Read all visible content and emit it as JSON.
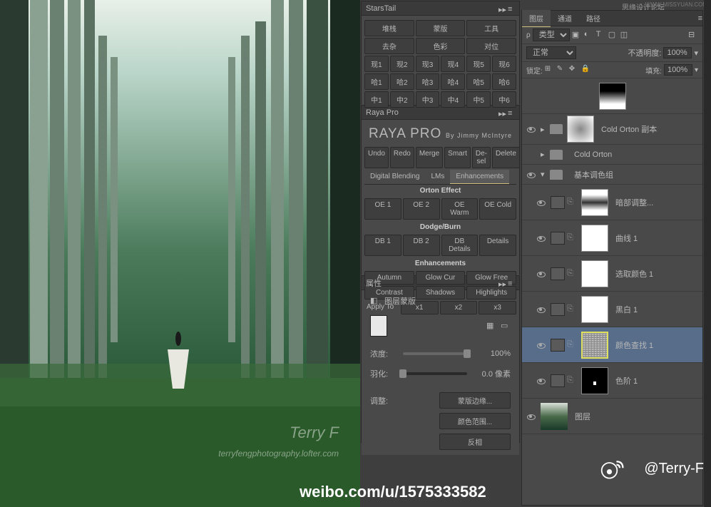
{
  "watermark_top": "思缘设计论坛",
  "watermark_top2": "WWW.MISSYUAN.COM",
  "canvas": {
    "wm_name": "Terry F",
    "wm_site": "terryfengphotography.lofter.com"
  },
  "starsTail": {
    "title": "StarsTail",
    "row1": [
      "堆栈",
      "蒙版",
      "工具"
    ],
    "row2": [
      "去杂",
      "色彩",
      "对位"
    ],
    "row3": [
      "现1",
      "现2",
      "现3",
      "现4",
      "现5",
      "现6"
    ],
    "row4": [
      "哈1",
      "哈2",
      "哈3",
      "哈4",
      "哈5",
      "哈6"
    ],
    "row5": [
      "中1",
      "中2",
      "中3",
      "中4",
      "中5",
      "中6"
    ]
  },
  "rayaPro": {
    "panel_title": "Raya Pro",
    "brand": "RAYA PRO",
    "by": "By Jimmy McIntyre",
    "actions": [
      "Undo",
      "Redo",
      "Merge",
      "Smart",
      "De-sel",
      "Delete"
    ],
    "tabs": [
      "Digital Blending",
      "LMs",
      "Enhancements"
    ],
    "activeTab": 2,
    "sec1": "Orton Effect",
    "sec1btns": [
      "OE 1",
      "OE 2",
      "OE Warm",
      "OE Cold"
    ],
    "sec2": "Dodge/Burn",
    "sec2btns": [
      "DB 1",
      "DB 2",
      "DB Details",
      "Details"
    ],
    "sec3": "Enhancements",
    "sec3btns1": [
      "Autumn",
      "Glow Cur",
      "Glow Free"
    ],
    "sec3btns2": [
      "Contrast",
      "Shadows",
      "Highlights"
    ],
    "apply": "Apply To",
    "applyBtns": [
      "x1",
      "x2",
      "x3"
    ]
  },
  "props": {
    "title": "属性",
    "mask_label": "图层蒙版",
    "density_label": "浓度:",
    "density_val": "100%",
    "feather_label": "羽化:",
    "feather_val": "0.0 像素",
    "adjust_label": "调整:",
    "btn1": "蒙版边缘...",
    "btn2": "颜色范围...",
    "btn3": "反相"
  },
  "layers": {
    "tabs": [
      "图层",
      "通道",
      "路径"
    ],
    "activeTab": 0,
    "filter_label": "类型",
    "blend": "正常",
    "opacity_label": "不透明度:",
    "opacity_val": "100%",
    "lock_label": "锁定:",
    "fill_label": "填充:",
    "fill_val": "100%",
    "items": [
      {
        "type": "mask-top"
      },
      {
        "type": "group",
        "name": "Cold Orton 副本",
        "mask": "grad2"
      },
      {
        "type": "group",
        "name": "Cold Orton"
      },
      {
        "type": "group",
        "name": "基本调色组",
        "open": true
      },
      {
        "type": "adj",
        "name": "暗部调整...",
        "mask": "grad3"
      },
      {
        "type": "adj",
        "name": "曲线 1",
        "mask": "white"
      },
      {
        "type": "adj",
        "name": "选取颜色 1",
        "mask": "white"
      },
      {
        "type": "adj",
        "name": "黑白 1",
        "mask": "white"
      },
      {
        "type": "adj",
        "name": "颜色查找 1",
        "mask": "noise",
        "selected": true
      },
      {
        "type": "adj",
        "name": "色阶 1",
        "mask": "dot"
      },
      {
        "type": "img",
        "name": "图层"
      }
    ]
  },
  "footer": {
    "at": "@Terry-F",
    "url": "weibo.com/u/1575333582"
  }
}
